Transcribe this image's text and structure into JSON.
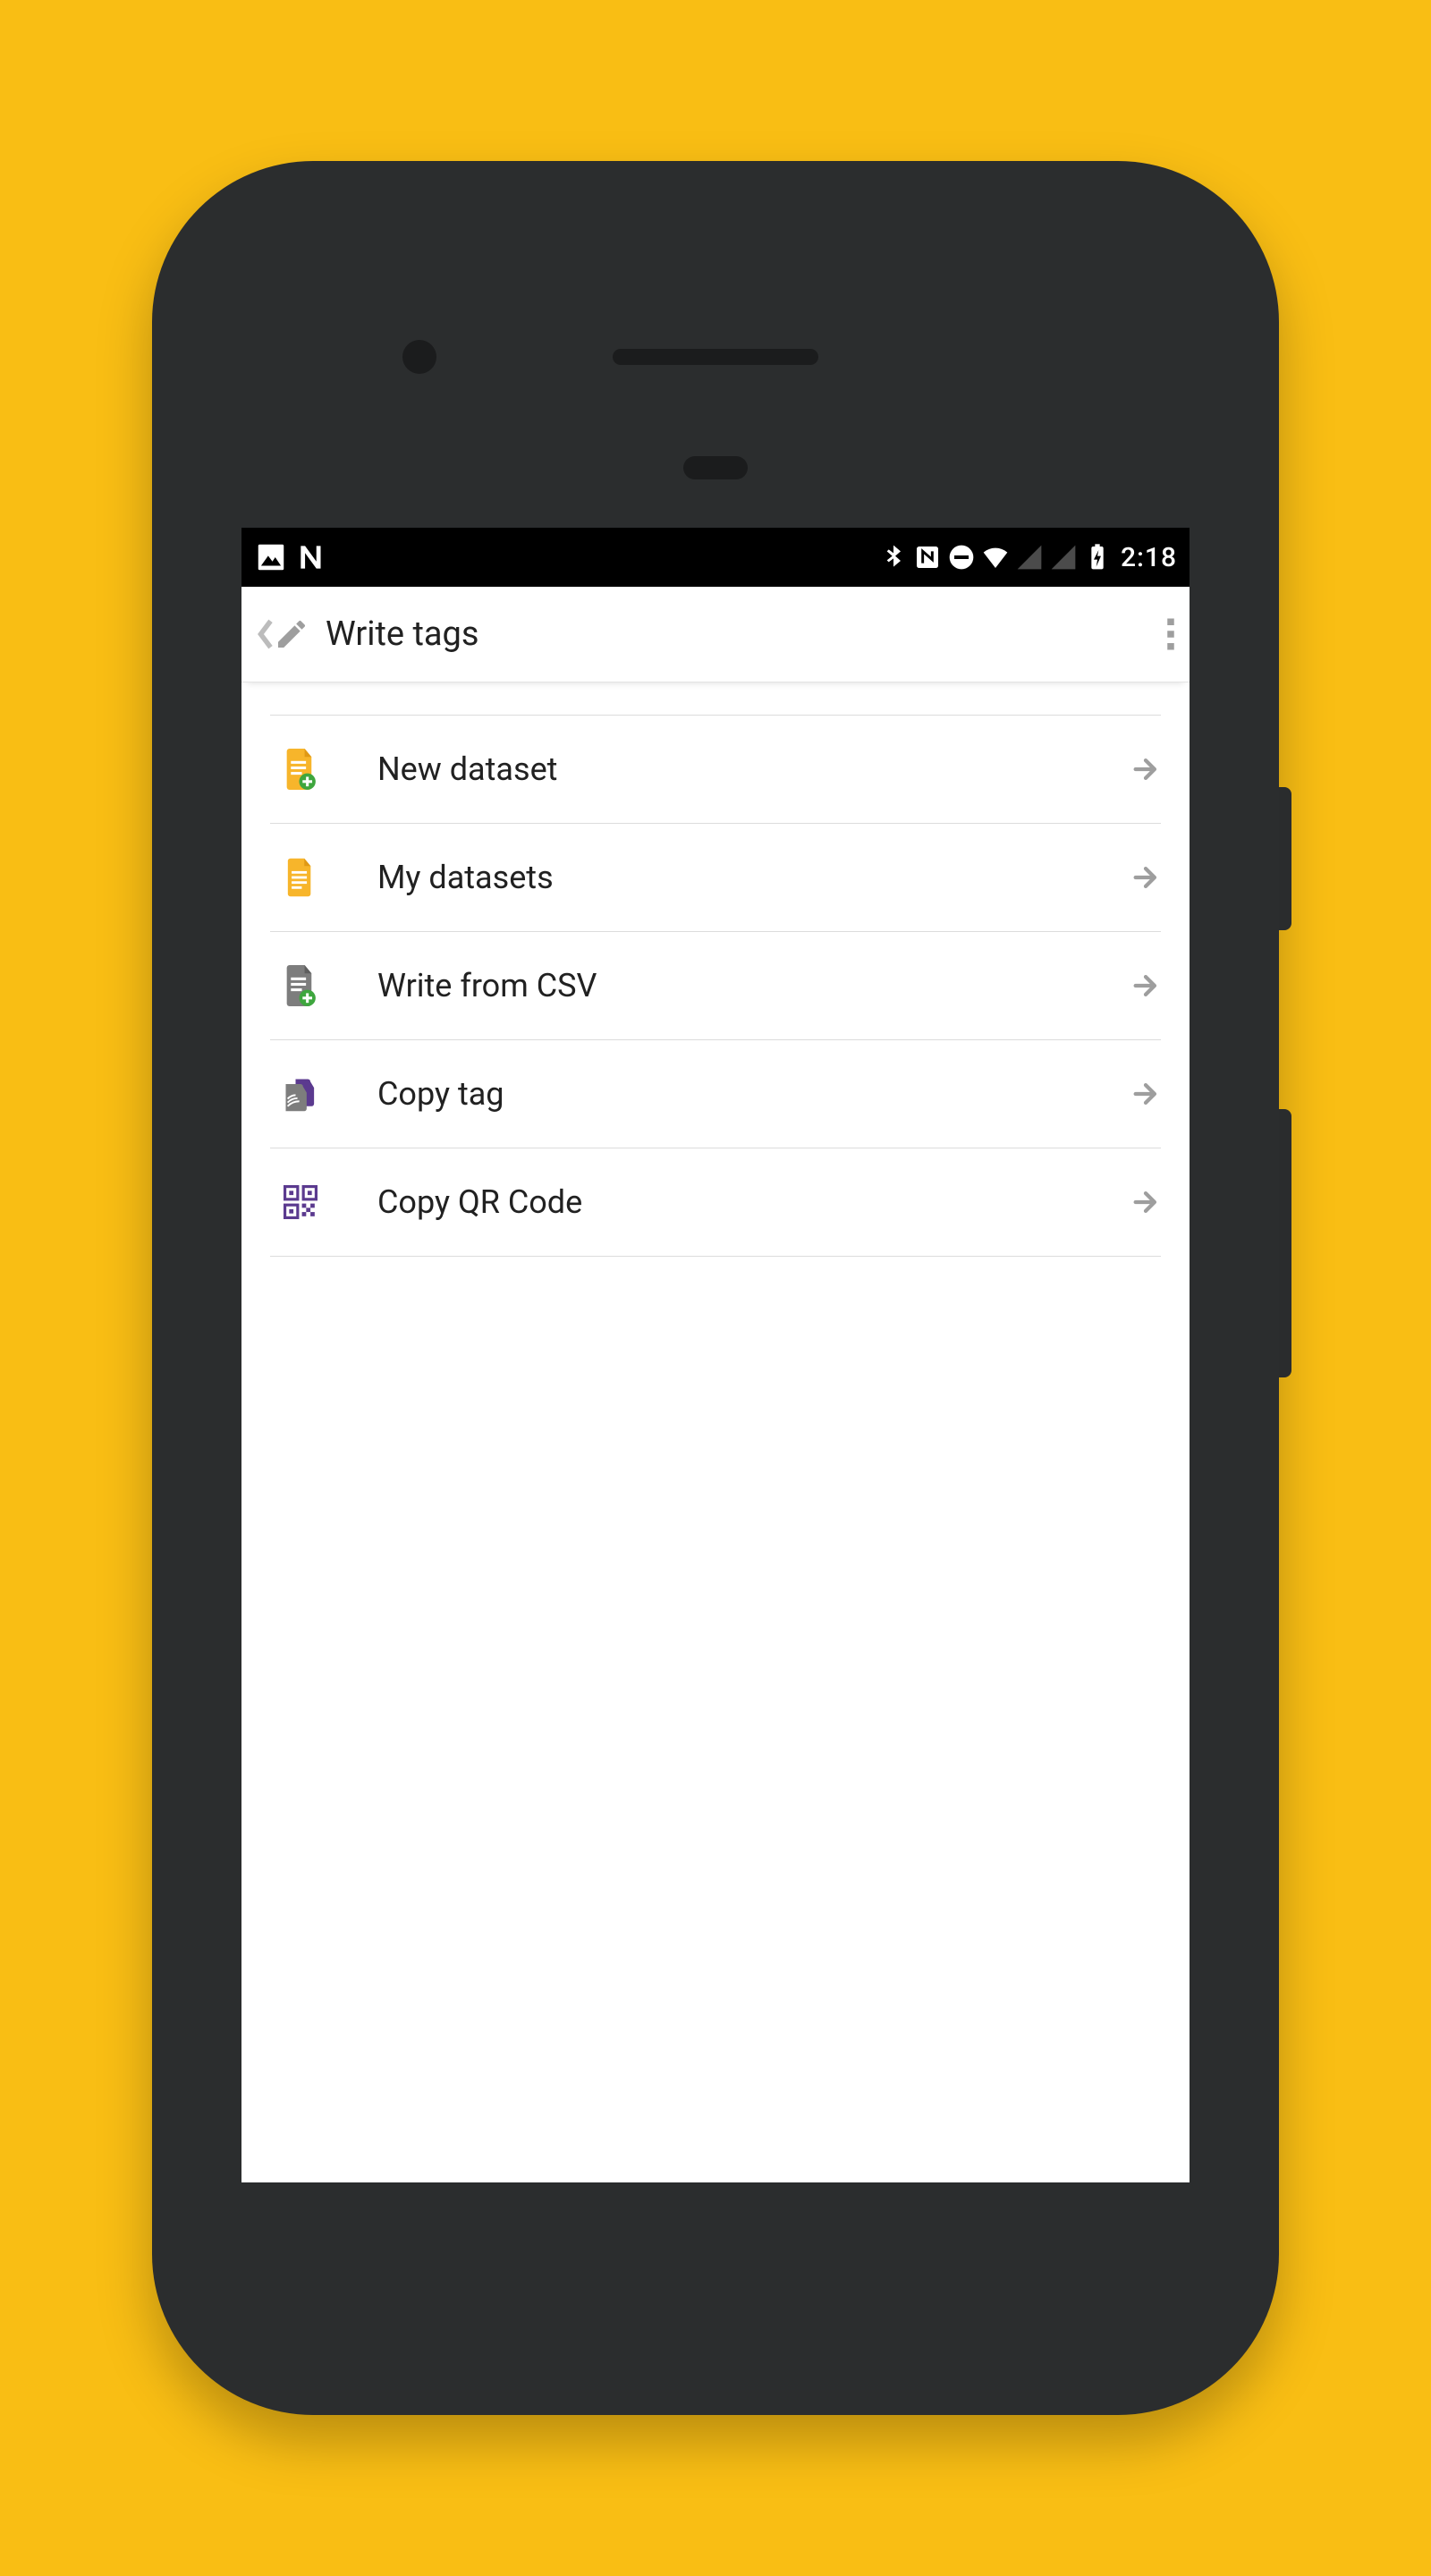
{
  "status": {
    "time": "2:18",
    "left_icons": [
      "picture-icon",
      "android-n-icon"
    ],
    "right_icons": [
      "bluetooth-icon",
      "nfc-icon",
      "dnd-icon",
      "wifi-icon",
      "signal-1-icon",
      "signal-2-icon",
      "battery-charging-icon"
    ]
  },
  "appbar": {
    "title": "Write tags"
  },
  "menu": {
    "items": [
      {
        "icon": "file-add-icon",
        "label": "New dataset"
      },
      {
        "icon": "file-icon",
        "label": "My datasets"
      },
      {
        "icon": "file-csv-icon",
        "label": "Write from CSV"
      },
      {
        "icon": "copy-tag-icon",
        "label": "Copy tag"
      },
      {
        "icon": "qr-icon",
        "label": "Copy QR Code"
      }
    ]
  }
}
